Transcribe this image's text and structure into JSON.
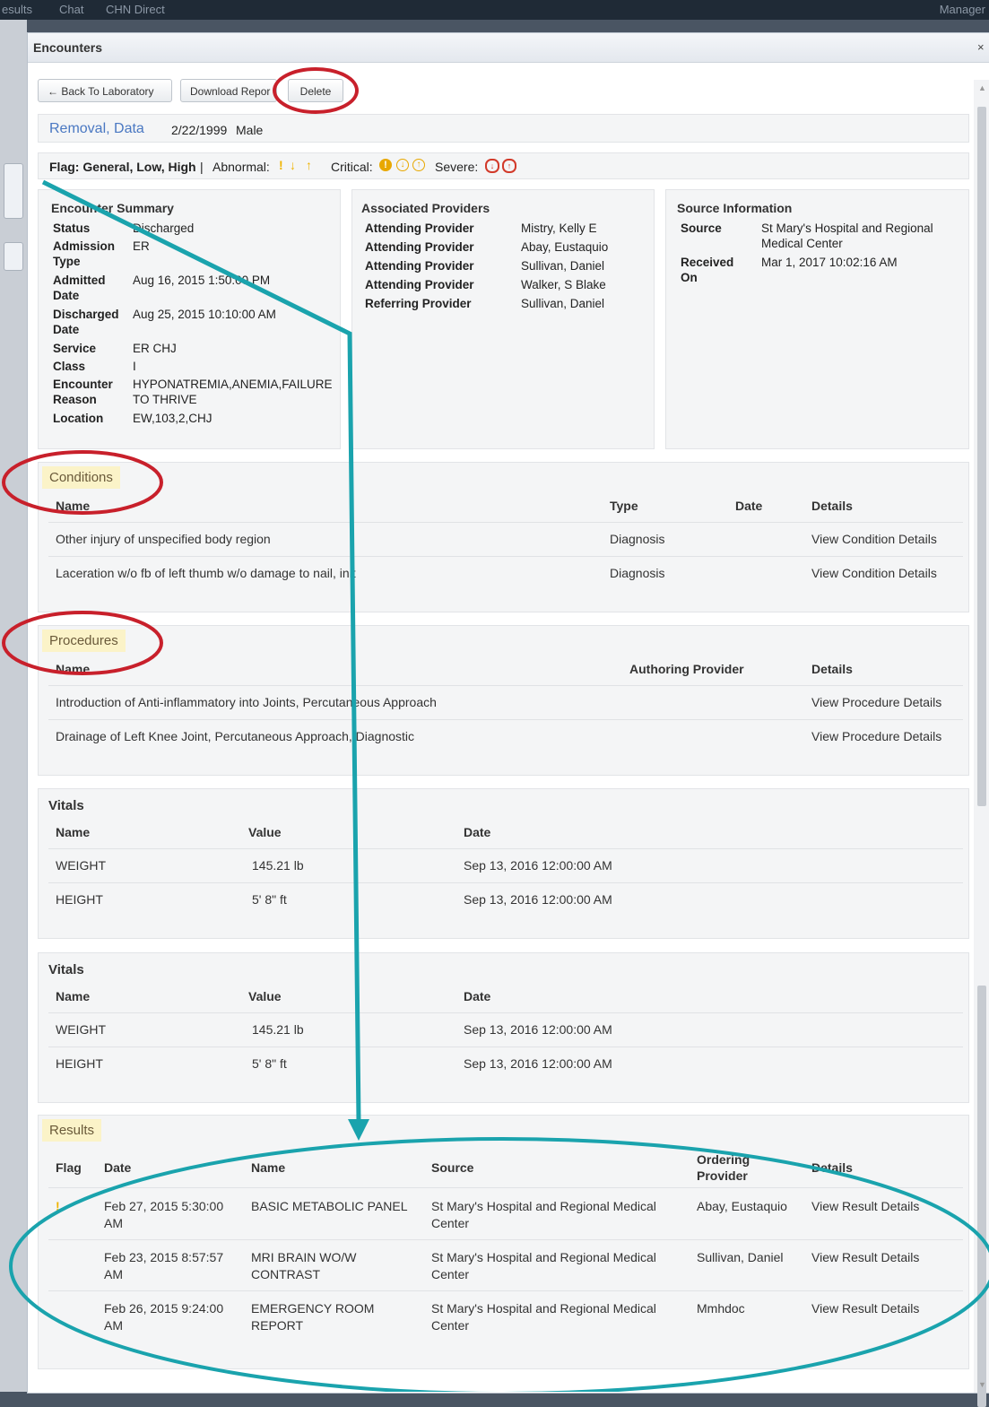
{
  "topbar": {
    "items": [
      "esults",
      "Chat",
      "CHN Direct"
    ],
    "right": "Manager"
  },
  "modal": {
    "title": "Encounters",
    "close": "×"
  },
  "toolbar": {
    "back_label": "← Back To Laboratory",
    "download_label": "Download Repor",
    "delete_label": "Delete"
  },
  "patient": {
    "name": "Removal, Data",
    "dob": "2/22/1999",
    "sex": "Male"
  },
  "flags": {
    "general": "Flag: General, Low, High",
    "sep": "|",
    "abnormal_label": "Abnormal:",
    "abnormal_icons": [
      "!",
      "↓",
      "↑"
    ],
    "critical_label": "Critical:",
    "critical_icons": [
      "!",
      "↓",
      "↑"
    ],
    "severe_label": "Severe:",
    "severe_icons": [
      "↓",
      "↑"
    ],
    "colors": {
      "abnormal": "#f0b400",
      "critical": "#e8a800",
      "severe": "#d23a2a"
    }
  },
  "encounter_summary": {
    "title": "Encounter Summary",
    "rows": [
      {
        "label": "Status",
        "value": "Discharged"
      },
      {
        "label": "Admission Type",
        "value": "ER"
      },
      {
        "label": "Admitted Date",
        "value": "Aug 16, 2015 1:50:00 PM"
      },
      {
        "label": "Discharged Date",
        "value": "Aug 25, 2015 10:10:00 AM"
      },
      {
        "label": "Service",
        "value": "ER CHJ"
      },
      {
        "label": "Class",
        "value": "I"
      },
      {
        "label": "Encounter Reason",
        "value": "HYPONATREMIA,ANEMIA,FAILURE TO THRIVE"
      },
      {
        "label": "Location",
        "value": "EW,103,2,CHJ"
      }
    ]
  },
  "providers": {
    "title": "Associated Providers",
    "rows": [
      {
        "label": "Attending Provider",
        "value": "Mistry, Kelly E"
      },
      {
        "label": "Attending Provider",
        "value": "Abay, Eustaquio"
      },
      {
        "label": "Attending Provider",
        "value": "Sullivan, Daniel"
      },
      {
        "label": "Attending Provider",
        "value": "Walker, S Blake"
      },
      {
        "label": "Referring Provider",
        "value": "Sullivan, Daniel"
      }
    ]
  },
  "source": {
    "title": "Source Information",
    "rows": [
      {
        "label": "Source",
        "value": "St Mary's Hospital and Regional Medical Center"
      },
      {
        "label": "Received On",
        "value": "Mar 1, 2017 10:02:16 AM"
      }
    ]
  },
  "conditions": {
    "title": "Conditions",
    "headers": [
      "Name",
      "Type",
      "Date",
      "Details"
    ],
    "rows": [
      {
        "name": "Other injury of unspecified body region",
        "type": "Diagnosis",
        "date": "",
        "details": "View Condition Details"
      },
      {
        "name": "Laceration w/o fb of left thumb w/o damage to nail, init",
        "type": "Diagnosis",
        "date": "",
        "details": "View Condition Details"
      }
    ]
  },
  "procedures": {
    "title": "Procedures",
    "headers": [
      "Name",
      "Authoring Provider",
      "Details"
    ],
    "rows": [
      {
        "name": "Introduction of Anti-inflammatory into Joints, Percutaneous Approach",
        "provider": "",
        "details": "View Procedure Details"
      },
      {
        "name": "Drainage of Left Knee Joint, Percutaneous Approach, Diagnostic",
        "provider": "",
        "details": "View Procedure Details"
      }
    ]
  },
  "vitals": [
    {
      "title": "Vitals",
      "headers": [
        "Name",
        "Value",
        "Date"
      ],
      "rows": [
        {
          "name": "WEIGHT",
          "value": "145.21 lb",
          "date": "Sep 13, 2016 12:00:00 AM"
        },
        {
          "name": "HEIGHT",
          "value": "5' 8\" ft",
          "date": "Sep 13, 2016 12:00:00 AM"
        }
      ]
    },
    {
      "title": "Vitals",
      "headers": [
        "Name",
        "Value",
        "Date"
      ],
      "rows": [
        {
          "name": "WEIGHT",
          "value": "145.21 lb",
          "date": "Sep 13, 2016 12:00:00 AM"
        },
        {
          "name": "HEIGHT",
          "value": "5' 8\" ft",
          "date": "Sep 13, 2016 12:00:00 AM"
        }
      ]
    }
  ],
  "results": {
    "title": "Results",
    "headers": [
      "Flag",
      "Date",
      "Name",
      "Source",
      "Ordering Provider",
      "Details"
    ],
    "rows": [
      {
        "flag": "!",
        "date": "Feb 27, 2015 5:30:00 AM",
        "name": "BASIC METABOLIC PANEL",
        "source": "St Mary's Hospital and Regional Medical Center",
        "provider": "Abay, Eustaquio",
        "details": "View Result Details"
      },
      {
        "flag": "",
        "date": "Feb 23, 2015 8:57:57 AM",
        "name": "MRI BRAIN WO/W CONTRAST",
        "source": "St Mary's Hospital and Regional Medical Center",
        "provider": "Sullivan, Daniel",
        "details": "View Result Details"
      },
      {
        "flag": "",
        "date": "Feb 26, 2015 9:24:00 AM",
        "name": "EMERGENCY ROOM REPORT",
        "source": "St Mary's Hospital and Regional Medical Center",
        "provider": "Mmhdoc",
        "details": "View Result Details"
      }
    ]
  },
  "annotation_colors": {
    "red_circle": "#c8202b",
    "teal": "#1aa3ad"
  }
}
